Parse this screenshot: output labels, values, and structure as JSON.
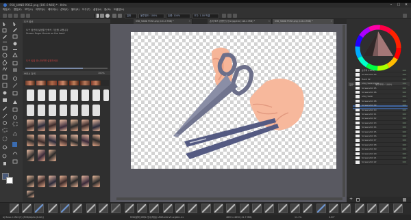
{
  "window": {
    "title": "058_HAND POSE.png (101.0 MiB) * - Krita",
    "icon": "krita-icon"
  },
  "menu": [
    "파일(F)",
    "편집(E)",
    "보기(V)",
    "이미지(I)",
    "레이어(L)",
    "선택(S)",
    "필터(R)",
    "도구(T)",
    "설정(N)",
    "창(W)",
    "도움말(H)"
  ],
  "toolbar": {
    "blend_mode": "일반",
    "opacity_label": "불투명도: 100%",
    "flow_label": "흐름: 100%",
    "size_label": "크기: 1.00 픽셀"
  },
  "left_docker": {
    "title": "도구 옵션",
    "hint_line1": "도구 옵션에 설정할 단축키 기호를 고릅니다",
    "hint_line2": "Screen finger thumb on the hand",
    "warning": "도구 팁을 표시하려면 설정하세요",
    "search_label": "브러시 검색",
    "zoom_value": "100%"
  },
  "tabs": [
    {
      "label": "058_HAND POSE.png (101.0 MiB) *"
    },
    {
      "label": "손의 포즈 (영향선) 참고.jpg.kra (118.4 MiB) *"
    },
    {
      "label": "058_HAND POSE.png (118.4 MiB) *"
    }
  ],
  "right_panel": {
    "layers_title": "레이어",
    "blend": "일반",
    "opacity": "불투명도: 100%",
    "layers": [
      {
        "name": "손가락 (Hand)",
        "opacity": "100"
      },
      {
        "name": "Screenshot 03",
        "opacity": "100"
      },
      {
        "name": "Hand 02",
        "opacity": "100"
      },
      {
        "name": "058_HAND POSE",
        "opacity": "100"
      },
      {
        "name": "Screenshot 05",
        "opacity": "100"
      },
      {
        "name": "Screenshot 06",
        "opacity": "100"
      },
      {
        "name": "058_HAND",
        "opacity": "100"
      },
      {
        "name": "Screenshot 08",
        "opacity": "100"
      },
      {
        "name": "Screenshot 09",
        "opacity": "100"
      },
      {
        "name": "Screenshot 10",
        "opacity": "100"
      },
      {
        "name": "Screenshot 11",
        "opacity": "100"
      },
      {
        "name": "Screenshot 12",
        "opacity": "100"
      },
      {
        "name": "Screenshot 13",
        "opacity": "100"
      },
      {
        "name": "Screenshot 14",
        "opacity": "100"
      },
      {
        "name": "Screenshot 15",
        "opacity": "100"
      },
      {
        "name": "Screenshot 16",
        "opacity": "100"
      },
      {
        "name": "Screenshot 17",
        "opacity": "100"
      },
      {
        "name": "Screenshot 18",
        "opacity": "100"
      },
      {
        "name": "Screenshot 19",
        "opacity": "100"
      },
      {
        "name": "Screenshot 20",
        "opacity": "100"
      },
      {
        "name": "Screenshot 21",
        "opacity": "100"
      },
      {
        "name": "Screenshot 22",
        "opacity": "100"
      }
    ]
  },
  "status": {
    "left": "b) Basic-1 Wet (5) (RGB/Alpha (8-bit))",
    "middle": "RGB/알파 (8비트 정수/채널) sRGB-elle-V2-srgbtrc.icc",
    "size": "4850 x 4850 (41.7 MiB)",
    "zoom": "11.1%",
    "rotation": "0.00°"
  },
  "colors": {
    "accent": "#4a90d9",
    "canvas_bg": "#595961",
    "panel_bg": "#2f2f2f",
    "warning": "#c04040"
  }
}
